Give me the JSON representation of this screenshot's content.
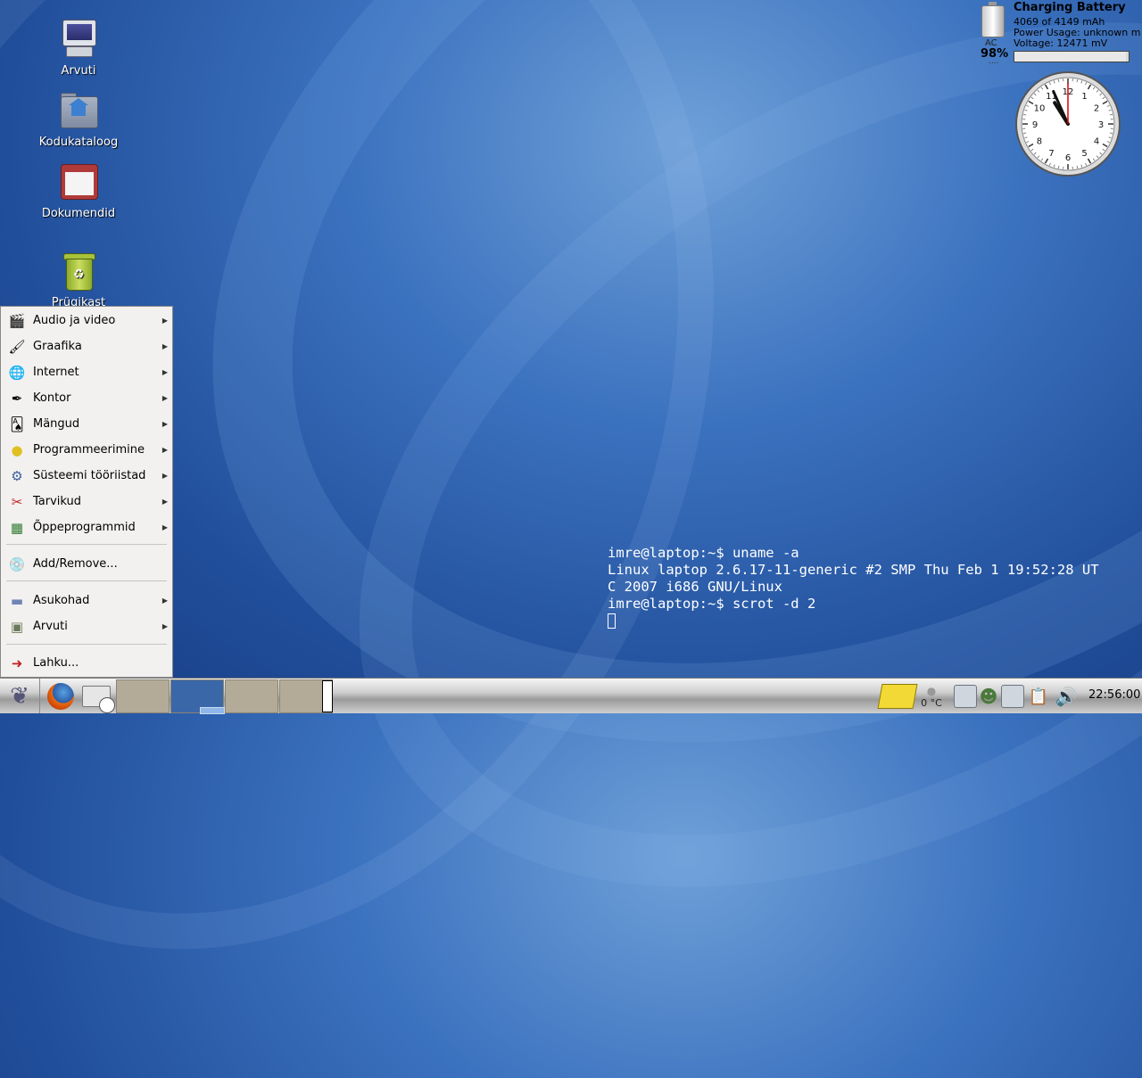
{
  "desktop": {
    "icons": [
      {
        "label": "Arvuti"
      },
      {
        "label": "Kodukataloog"
      },
      {
        "label": "Dokumendid"
      },
      {
        "label": "Prügikast"
      }
    ]
  },
  "battery": {
    "title": "Charging Battery",
    "capacity": "4069 of 4149 mAh",
    "power": "Power Usage: unknown m",
    "voltage": "Voltage: 12471 mV",
    "source": "AC",
    "percent": "98%",
    "dots": "....",
    "level": 0.98
  },
  "clock_widget": {
    "numbers": [
      "12",
      "1",
      "2",
      "3",
      "4",
      "5",
      "6",
      "7",
      "8",
      "9",
      "10",
      "11"
    ],
    "time": "10:56:00"
  },
  "menu": {
    "items": [
      {
        "label": "Audio ja video",
        "icon": "clapperboard-icon",
        "submenu": true
      },
      {
        "label": "Graafika",
        "icon": "paintbrush-icon",
        "submenu": true
      },
      {
        "label": "Internet",
        "icon": "globe-icon",
        "submenu": true
      },
      {
        "label": "Kontor",
        "icon": "office-icon",
        "submenu": true
      },
      {
        "label": "Mängud",
        "icon": "cards-icon",
        "submenu": true
      },
      {
        "label": "Programmeerimine",
        "icon": "helmet-icon",
        "submenu": true
      },
      {
        "label": "Süsteemi tööriistad",
        "icon": "gear-icon",
        "submenu": true
      },
      {
        "label": "Tarvikud",
        "icon": "scissors-icon",
        "submenu": true
      },
      {
        "label": "Õppeprogrammid",
        "icon": "chalkboard-icon",
        "submenu": true
      }
    ],
    "add_remove": "Add/Remove...",
    "places": [
      {
        "label": "Asukohad",
        "icon": "folder-icon",
        "submenu": true
      },
      {
        "label": "Arvuti",
        "icon": "computer-icon",
        "submenu": true
      }
    ],
    "logout": "Lahku..."
  },
  "terminal": {
    "line1": "imre@laptop:~$ uname -a",
    "line2": "Linux laptop 2.6.17-11-generic #2 SMP Thu Feb 1 19:52:28 UT",
    "line3": "C 2007 i686 GNU/Linux",
    "line4": "imre@laptop:~$ scrot -d 2"
  },
  "taskbar": {
    "temperature": "0 °C",
    "clock": "22:56:00"
  }
}
